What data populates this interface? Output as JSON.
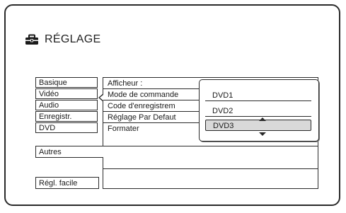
{
  "header": {
    "title": "RÉGLAGE",
    "icon": "toolbox-icon"
  },
  "sidebar": {
    "items": [
      {
        "label": "Basique"
      },
      {
        "label": "Vidéo"
      },
      {
        "label": "Audio"
      },
      {
        "label": "Enregistr."
      },
      {
        "label": "DVD"
      }
    ],
    "selected_label": "Autres",
    "bottom_label": "Régl. facile"
  },
  "settings": {
    "rows": [
      {
        "label": "Afficheur :"
      },
      {
        "label": "Mode de commande"
      },
      {
        "label": "Code d'enregistrem"
      },
      {
        "label": "Réglage Par Defaut"
      },
      {
        "label": "Formater"
      }
    ]
  },
  "popup": {
    "options": [
      {
        "label": "DVD1"
      },
      {
        "label": "DVD2"
      },
      {
        "label": "DVD3"
      }
    ],
    "selected_index": 2
  },
  "colors": {
    "line": "#2a2a2a",
    "selected_bg": "#d9d9d9",
    "background": "#ffffff"
  }
}
